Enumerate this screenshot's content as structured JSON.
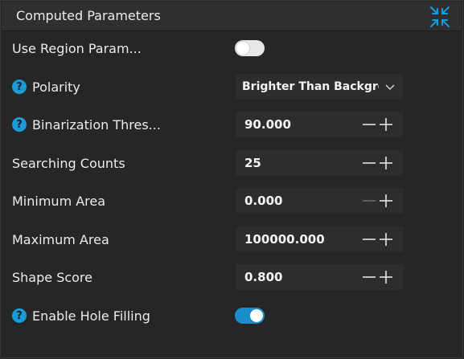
{
  "panel": {
    "title": "Computed Parameters",
    "collapse_icon": "collapse-arrows-icon",
    "accent_color": "#1a9ad6"
  },
  "rows": {
    "use_region": {
      "label": "Use Region Param...",
      "help": false,
      "toggle": false
    },
    "polarity": {
      "label": "Polarity",
      "help": true,
      "value": "Brighter Than Background"
    },
    "binarization": {
      "label": "Binarization Thres...",
      "help": true,
      "value": "90.000"
    },
    "searching_counts": {
      "label": "Searching Counts",
      "help": false,
      "value": "25"
    },
    "minimum_area": {
      "label": "Minimum Area",
      "help": false,
      "value": "0.000",
      "minus_disabled": true
    },
    "maximum_area": {
      "label": "Maximum Area",
      "help": false,
      "value": "100000.000"
    },
    "shape_score": {
      "label": "Shape Score",
      "help": false,
      "value": "0.800"
    },
    "hole_filling": {
      "label": "Enable Hole Filling",
      "help": true,
      "toggle": true
    }
  },
  "help_glyph": "?"
}
